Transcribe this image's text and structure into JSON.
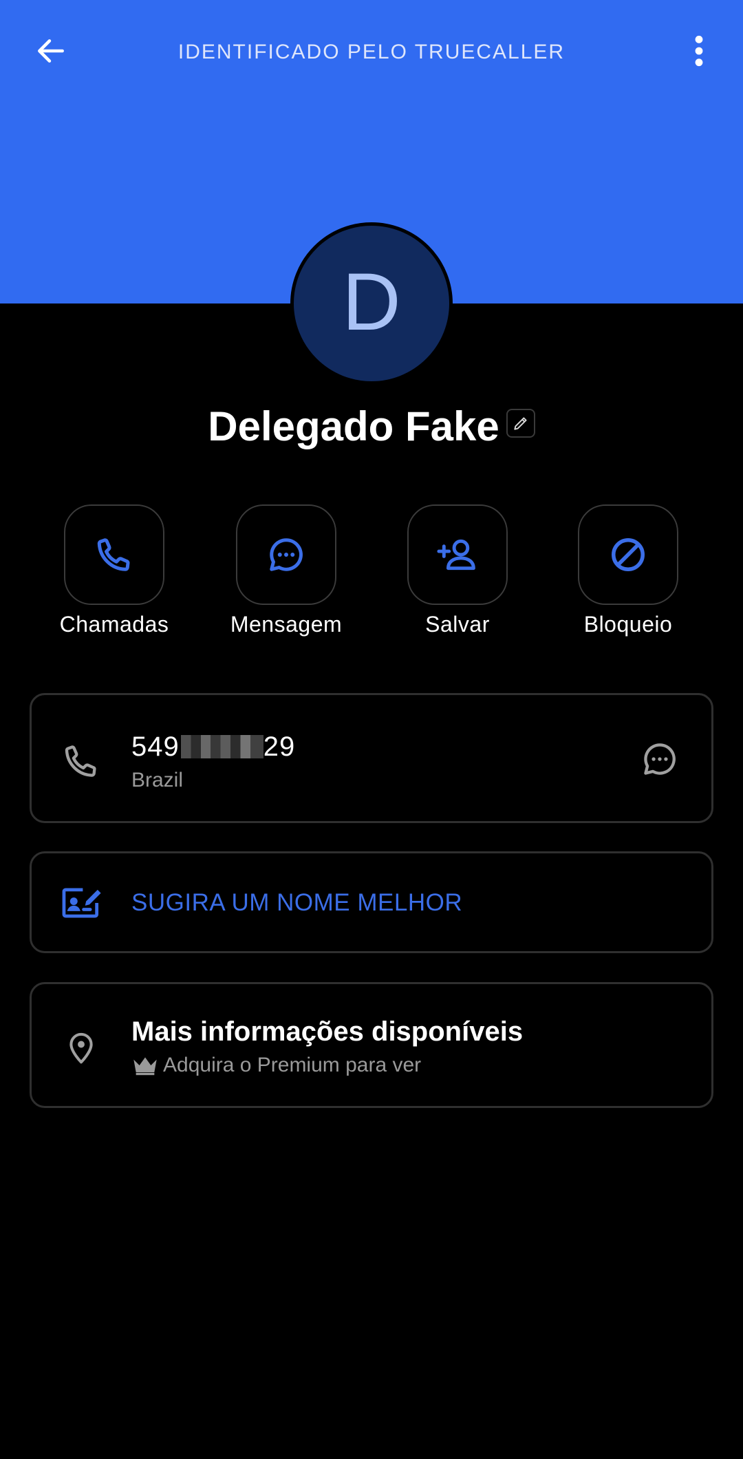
{
  "header": {
    "title": "IDENTIFICADO PELO TRUECALLER",
    "background_color": "#316BF1"
  },
  "contact": {
    "initial": "D",
    "name": "Delegado Fake"
  },
  "actions": [
    {
      "label": "Chamadas",
      "icon": "phone-icon"
    },
    {
      "label": "Mensagem",
      "icon": "chat-bubble-icon"
    },
    {
      "label": "Salvar",
      "icon": "add-person-icon"
    },
    {
      "label": "Bloqueio",
      "icon": "block-icon"
    }
  ],
  "number_card": {
    "number_prefix": "549",
    "number_suffix": "29",
    "country": "Brazil"
  },
  "suggest_card": {
    "label": "SUGIRA UM NOME MELHOR"
  },
  "more_info_card": {
    "title": "Mais informações disponíveis",
    "subtitle": "Adquira o Premium para ver"
  },
  "colors": {
    "accent": "#3B6EE8",
    "background": "#000000",
    "avatar_bg": "#112A5E"
  }
}
